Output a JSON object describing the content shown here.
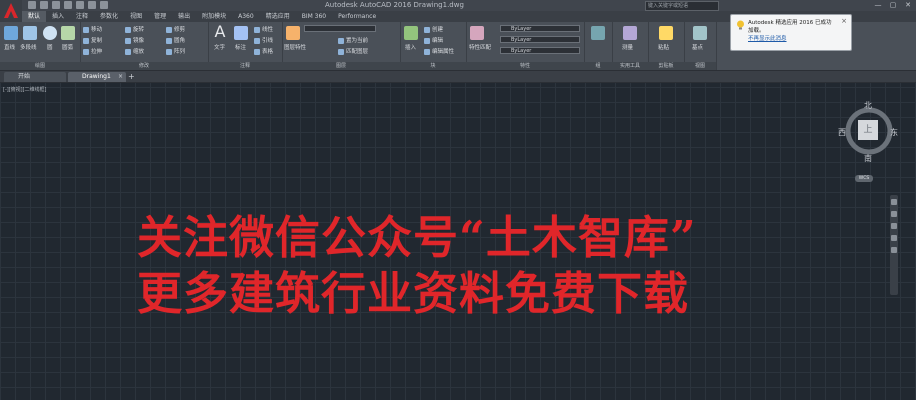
{
  "title_bar": {
    "title": "Autodesk AutoCAD 2016   Drawing1.dwg",
    "search_placeholder": "键入关键字或短语",
    "window_controls": [
      "—",
      "▢",
      "✕"
    ]
  },
  "ribbon_tabs": [
    "默认",
    "插入",
    "注释",
    "参数化",
    "视图",
    "管理",
    "输出",
    "附加模块",
    "A360",
    "精选应用",
    "BIM 360",
    "Performance"
  ],
  "ribbon": {
    "draw_panel": {
      "label": "绘图",
      "line": "直线",
      "polyline": "多段线",
      "circle": "圆",
      "arc": "圆弧"
    },
    "modify_panel": {
      "label": "修改",
      "move": "移动",
      "rotate": "旋转",
      "copy": "复制",
      "mirror": "镜像",
      "stretch": "拉伸",
      "scale": "缩放",
      "trim": "修剪",
      "fillet": "圆角",
      "array": "阵列"
    },
    "annotation_panel": {
      "label": "注释",
      "text": "文字",
      "dimension": "标注",
      "linear": "线性",
      "leader": "引线",
      "table": "表格"
    },
    "layers_panel": {
      "label": "图层",
      "layer_props": "图层特性",
      "make_current": "置为当前",
      "match_layer": "匹配图层"
    },
    "block_panel": {
      "label": "块",
      "insert": "插入",
      "create": "创建",
      "edit": "编辑",
      "edit_attr": "编辑属性"
    },
    "properties_panel": {
      "label": "特性",
      "match_props": "特性匹配",
      "color": "ByLayer",
      "linetype": "ByLayer",
      "lineweight": "ByLayer"
    },
    "groups_panel": {
      "label": "组",
      "group": "组"
    },
    "utilities_panel": {
      "label": "实用工具",
      "measure": "测量"
    },
    "clipboard_panel": {
      "label": "剪贴板",
      "paste": "粘贴"
    },
    "view_panel": {
      "label": "视图",
      "base": "基点"
    }
  },
  "notification": {
    "title": "Autodesk 精选应用 2016 已成功",
    "body": "加载。",
    "link": "不再显示此消息"
  },
  "file_tabs": [
    {
      "label": "开始"
    },
    {
      "label": "Drawing1"
    }
  ],
  "canvas": {
    "viewport_label": "[-][俯视][二维线框]",
    "viewcube": {
      "north": "北",
      "south": "南",
      "east": "东",
      "west": "西",
      "top": "上"
    },
    "wcs": "WCS"
  },
  "overlay_text": {
    "line1": "关注微信公众号“土木智库”",
    "line2": "更多建筑行业资料免费下载"
  },
  "colors": {
    "canvas_bg": "#212830",
    "overlay_text": "#e0262a",
    "ribbon_bg": "#4a5058"
  }
}
